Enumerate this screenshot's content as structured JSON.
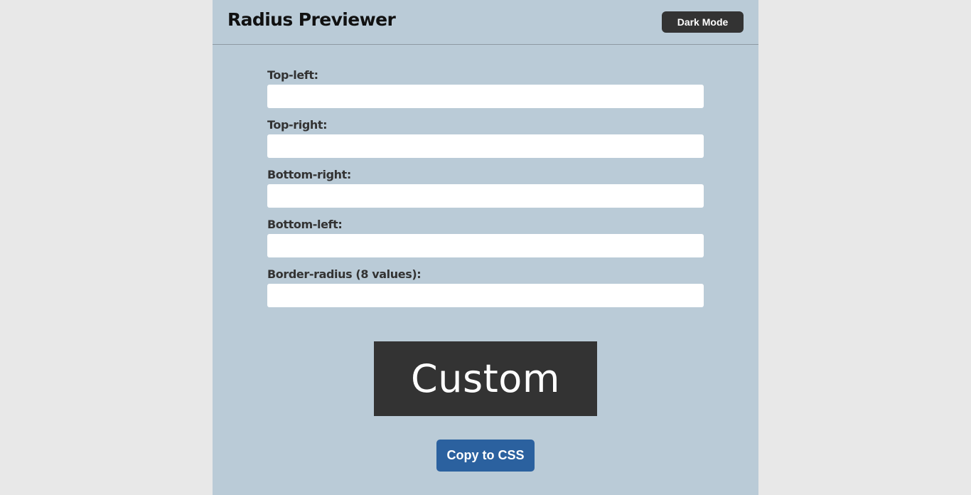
{
  "header": {
    "title": "Radius Previewer",
    "dark_mode_label": "Dark Mode"
  },
  "form": {
    "fields": [
      {
        "label": "Top-left:",
        "value": "",
        "placeholder": ""
      },
      {
        "label": "Top-right:",
        "value": "",
        "placeholder": ""
      },
      {
        "label": "Bottom-right:",
        "value": "",
        "placeholder": ""
      },
      {
        "label": "Bottom-left:",
        "value": "",
        "placeholder": ""
      },
      {
        "label": "Border-radius (8 values):",
        "value": "",
        "placeholder": ""
      }
    ]
  },
  "preview": {
    "text": "Custom"
  },
  "actions": {
    "copy_label": "Copy to CSS"
  },
  "colors": {
    "page_background": "#e8e8e8",
    "app_background": "#bacbd7",
    "preview_background": "#333333",
    "dark_button": "#333333",
    "copy_button": "#2b619f"
  }
}
